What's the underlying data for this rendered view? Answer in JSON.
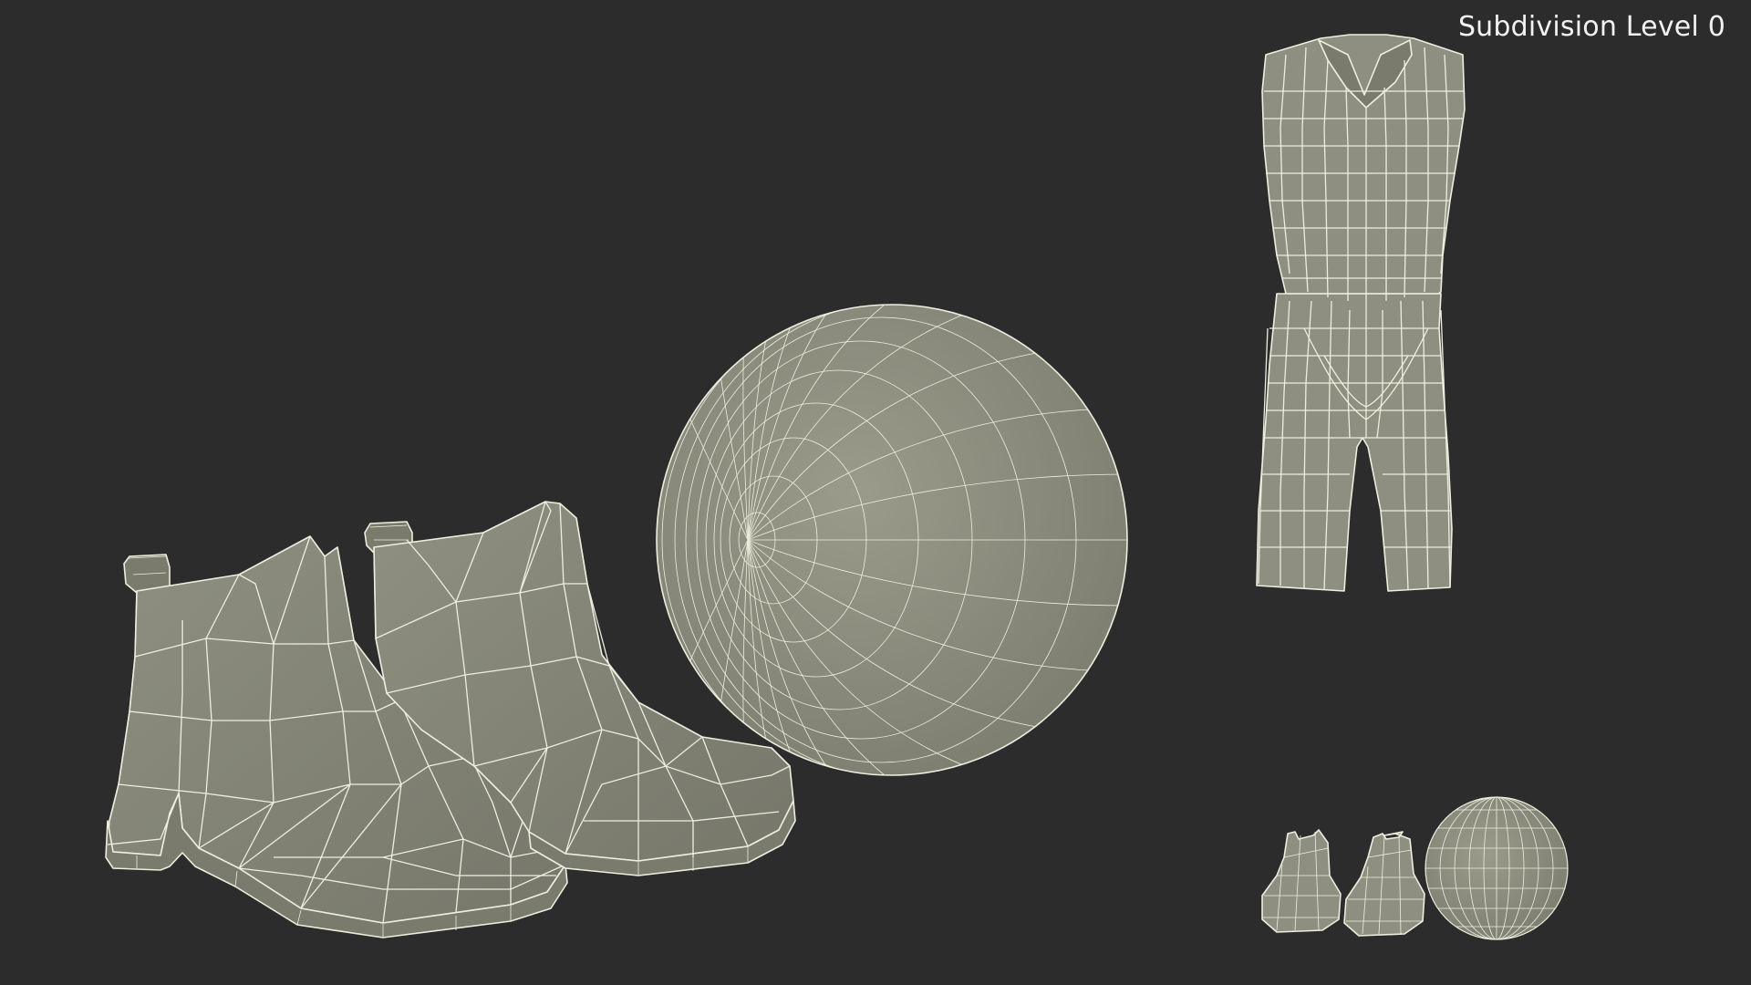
{
  "viewport": {
    "overlay_label": "Subdivision Level 0",
    "background_color": "#2c2c2c",
    "mesh_color": "#8e8f80",
    "wire_color": "#eeeede"
  }
}
